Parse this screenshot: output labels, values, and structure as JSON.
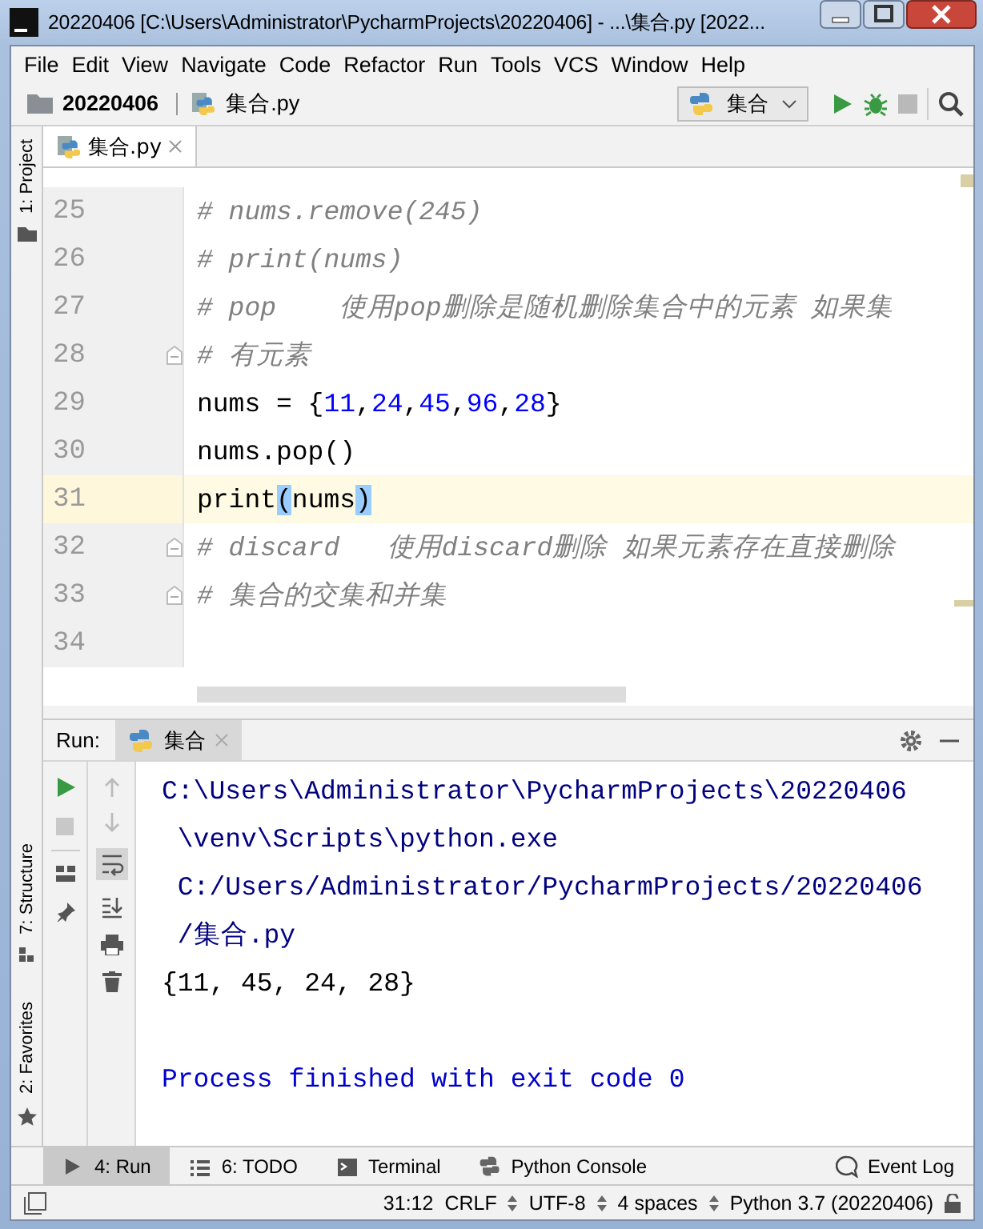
{
  "window": {
    "title": "20220406 [C:\\Users\\Administrator\\PycharmProjects\\20220406] - ...\\集合.py [2022..."
  },
  "menu": [
    {
      "label": "File"
    },
    {
      "label": "Edit"
    },
    {
      "label": "View"
    },
    {
      "label": "Navigate"
    },
    {
      "label": "Code"
    },
    {
      "label": "Refactor"
    },
    {
      "label": "Run"
    },
    {
      "label": "Tools"
    },
    {
      "label": "VCS"
    },
    {
      "label": "Window"
    },
    {
      "label": "Help"
    }
  ],
  "breadcrumbs": [
    "20220406",
    "集合.py"
  ],
  "run_config": "集合",
  "left_tools": [
    {
      "label": "1: Project"
    },
    {
      "label": "7: Structure"
    },
    {
      "label": "2: Favorites"
    }
  ],
  "editor_tabs": [
    {
      "label": "集合.py",
      "selected": true
    }
  ],
  "code_lines": [
    {
      "number": "25",
      "current": false,
      "fold": false,
      "tokens": [
        {
          "kind": "comment",
          "text": "# nums.remove(245)"
        }
      ]
    },
    {
      "number": "26",
      "current": false,
      "fold": false,
      "tokens": [
        {
          "kind": "comment",
          "text": "# print(nums)"
        }
      ]
    },
    {
      "number": "27",
      "current": false,
      "fold": false,
      "tokens": [
        {
          "kind": "comment",
          "text": "# pop    使用pop删除是随机删除集合中的元素 如果集"
        }
      ]
    },
    {
      "number": "28",
      "current": false,
      "fold": true,
      "tokens": [
        {
          "kind": "comment",
          "text": "# 有元素"
        }
      ]
    },
    {
      "number": "29",
      "current": false,
      "fold": false,
      "tokens": [
        {
          "kind": "plain",
          "text": "nums = {"
        },
        {
          "kind": "number",
          "text": "11"
        },
        {
          "kind": "plain",
          "text": ","
        },
        {
          "kind": "number",
          "text": "24"
        },
        {
          "kind": "plain",
          "text": ","
        },
        {
          "kind": "number",
          "text": "45"
        },
        {
          "kind": "plain",
          "text": ","
        },
        {
          "kind": "number",
          "text": "96"
        },
        {
          "kind": "plain",
          "text": ","
        },
        {
          "kind": "number",
          "text": "28"
        },
        {
          "kind": "plain",
          "text": "}"
        }
      ]
    },
    {
      "number": "30",
      "current": false,
      "fold": false,
      "tokens": [
        {
          "kind": "plain",
          "text": "nums.pop()"
        }
      ]
    },
    {
      "number": "31",
      "current": true,
      "fold": false,
      "tokens": [
        {
          "kind": "plain",
          "text": "print"
        },
        {
          "kind": "match",
          "text": "("
        },
        {
          "kind": "plain",
          "text": "nums"
        },
        {
          "kind": "match",
          "text": ")"
        }
      ]
    },
    {
      "number": "32",
      "current": false,
      "fold": true,
      "tokens": [
        {
          "kind": "comment",
          "text": "# discard   使用discard删除 如果元素存在直接删除"
        }
      ]
    },
    {
      "number": "33",
      "current": false,
      "fold": true,
      "tokens": [
        {
          "kind": "comment",
          "text": "# 集合的交集和并集"
        }
      ]
    },
    {
      "number": "34",
      "current": false,
      "fold": false
    }
  ],
  "run_panel": {
    "label": "Run:",
    "tabs": [
      {
        "label": "集合",
        "selected": true
      }
    ],
    "output": [
      {
        "kind": "path",
        "text": "C:\\Users\\Administrator\\PycharmProjects\\20220406"
      },
      {
        "kind": "path",
        "text": " \\venv\\Scripts\\python.exe"
      },
      {
        "kind": "path",
        "text": " C:/Users/Administrator/PycharmProjects/20220406"
      },
      {
        "kind": "path",
        "text": " /集合.py"
      },
      {
        "kind": "stdout",
        "text": "{11, 45, 24, 28}"
      },
      {
        "kind": "blank"
      },
      {
        "kind": "exit",
        "text": "Process finished with exit code 0"
      }
    ]
  },
  "bottom_tools": [
    {
      "label": "4: Run",
      "kind": "play",
      "selected": true
    },
    {
      "label": "6: TODO",
      "kind": "list",
      "selected": false
    },
    {
      "label": "Terminal",
      "kind": "terminal",
      "selected": false
    },
    {
      "label": "Python Console",
      "kind": "python",
      "selected": false
    },
    {
      "label": "Event Log",
      "kind": "bubble",
      "selected": false
    }
  ],
  "status_bar": {
    "position": "31:12",
    "line_sep": "CRLF",
    "encoding": "UTF-8",
    "indent": "4 spaces",
    "interpreter": "Python 3.7 (20220406)"
  }
}
